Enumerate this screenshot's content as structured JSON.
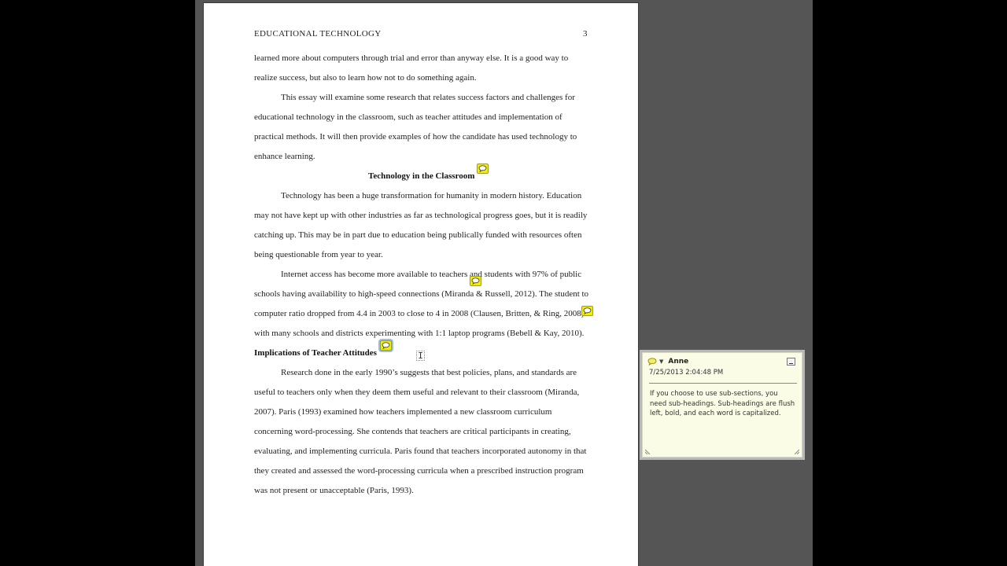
{
  "document": {
    "running_head": "EDUCATIONAL TECHNOLOGY",
    "page_number": "3",
    "lines": [
      "learned more about computers through trial and error than anyway else.  It is a good way to",
      "realize success, but also to learn how not to do something again.",
      "This essay will examine some research that relates success factors and challenges for",
      "educational technology in the classroom, such as teacher attitudes and implementation of",
      "practical methods.  It will then provide examples of how the candidate has used technology to",
      "enhance learning.",
      "Technology has been a huge transformation for humanity in modern history.  Education",
      "may not have kept up with other industries as far as technological progress goes, but it is readily",
      "catching up.  This may be in part due to education being publically funded with resources often",
      "being questionable from year to year.",
      "Internet access has become more available to teachers and students with 97% of public",
      "schools having availability to high-speed connections (Miranda & Russell, 2012).  The student to",
      "computer ratio dropped from 4.4 in 2003 to close to 4 in 2008 (Clausen, Britten, & Ring, 2008)",
      "with many schools and districts experimenting with 1:1 laptop programs (Bebell & Kay, 2010).",
      "Research done in the early 1990’s suggests that best policies, plans, and standards are",
      "useful to teachers only when they deem them useful and relevant to their classroom (Miranda,",
      "2007).  Paris (1993) examined how teachers implemented a new classroom curriculum",
      "concerning word-processing.  She contends that teachers are critical participants in creating,",
      "evaluating, and implementing curricula.  Paris found that teachers incorporated autonomy in that",
      "they created and assessed the word-processing curricula when a prescribed instruction program",
      "was not present or unacceptable (Paris, 1993)."
    ],
    "headings": {
      "section": "Technology in the Classroom",
      "subsection": "Implications of Teacher Attitudes"
    }
  },
  "comment_popup": {
    "author": "Anne",
    "date": "7/25/2013 2:04:48 PM",
    "text": "If you choose to use sub-sections, you need sub-headings. Sub-headings are flush left, bold, and each word is capitalized."
  },
  "colors": {
    "comment_marker": "#f2ef00",
    "popup_background": "#fbfce6",
    "workspace": "#555555"
  }
}
